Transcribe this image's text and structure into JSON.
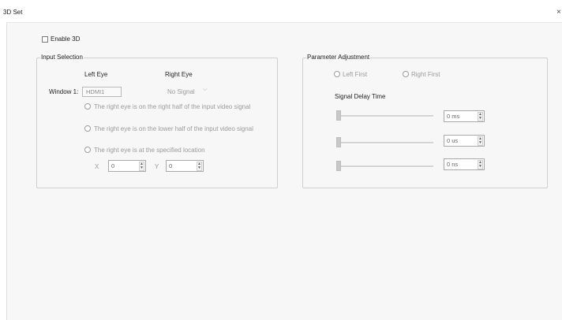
{
  "window": {
    "title": "3D Set",
    "close_glyph": "×"
  },
  "enable_3d": {
    "label": "Enable 3D",
    "checked": false
  },
  "input_selection": {
    "legend": "Input Selection",
    "left_eye_header": "Left Eye",
    "right_eye_header": "Right Eye",
    "window_label": "Window 1:",
    "left_eye_source": "HDMI1",
    "right_eye_source": "No Signal",
    "right_eye_dropdown_glyph": "⌵",
    "options": [
      "The right eye is on the right half of the input video signal",
      "The right eye is on the lower half of the input video signal",
      "The right eye is at the specified location"
    ],
    "x_label": "X",
    "x_value": "0",
    "y_label": "Y",
    "y_value": "0"
  },
  "parameter_adjustment": {
    "legend": "Parameter Adjustment",
    "left_first_label": "Left First",
    "right_first_label": "Right First",
    "signal_delay_label": "Signal Delay Time",
    "delays": [
      {
        "value": "0 ms"
      },
      {
        "value": "0 us"
      },
      {
        "value": "0 ns"
      }
    ],
    "spin_up_glyph": "▲",
    "spin_down_glyph": "▼"
  }
}
